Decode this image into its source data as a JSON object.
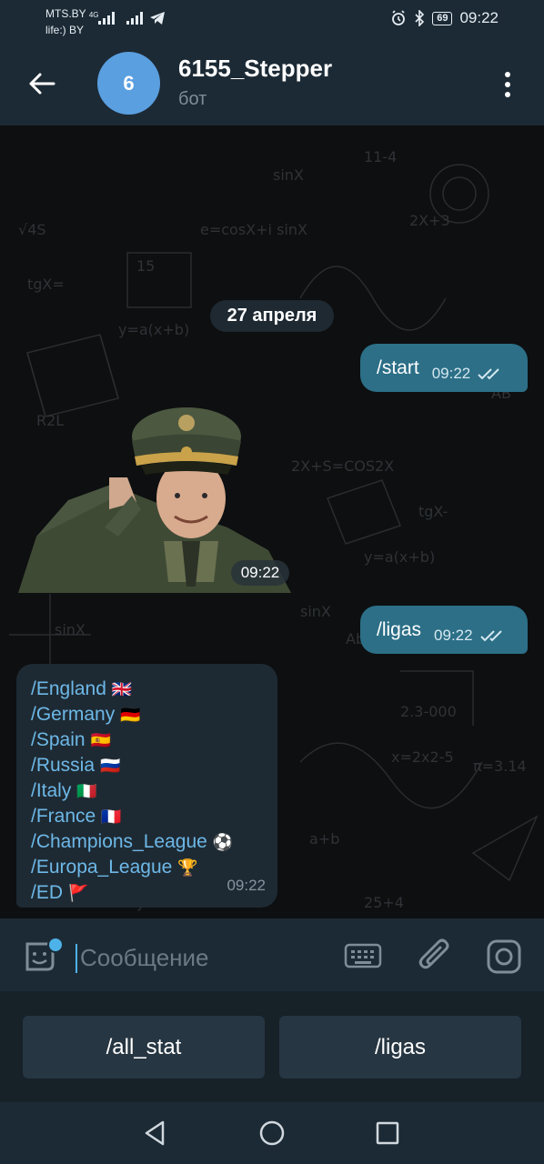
{
  "status_bar": {
    "carrier_line1": "MTS.BY",
    "carrier_tag": "4G",
    "carrier_line2": "life:) BY",
    "battery": "69",
    "time": "09:22"
  },
  "header": {
    "avatar_letter": "6",
    "title": "6155_Stepper",
    "subtitle": "бот"
  },
  "chat": {
    "date_divider": "27 апреля",
    "messages": [
      {
        "direction": "out",
        "text": "/start",
        "time": "09:22",
        "status": "read"
      },
      {
        "direction": "in",
        "type": "sticker",
        "time": "09:22"
      },
      {
        "direction": "out",
        "text": "/ligas",
        "time": "09:22",
        "status": "read"
      },
      {
        "direction": "in",
        "time": "09:22",
        "commands": [
          {
            "cmd": "/England",
            "emoji": "🇬🇧"
          },
          {
            "cmd": "/Germany",
            "emoji": "🇩🇪"
          },
          {
            "cmd": "/Spain",
            "emoji": "🇪🇸"
          },
          {
            "cmd": "/Russia",
            "emoji": "🇷🇺"
          },
          {
            "cmd": "/Italy",
            "emoji": "🇮🇹"
          },
          {
            "cmd": "/France",
            "emoji": "🇫🇷"
          },
          {
            "cmd": "/Champions_League",
            "emoji": "⚽"
          },
          {
            "cmd": "/Europa_League",
            "emoji": "🏆"
          },
          {
            "cmd": "/ED",
            "emoji": "🚩"
          }
        ]
      }
    ]
  },
  "composer": {
    "placeholder": "Сообщение"
  },
  "bot_keyboard": {
    "buttons": [
      "/all_stat",
      "/ligas"
    ]
  },
  "colors": {
    "header_bg": "#1c2a35",
    "outgoing_bubble": "#2c6f87",
    "incoming_bubble": "#1e2a33",
    "link": "#6db8e8",
    "avatar": "#5a9fe0"
  }
}
